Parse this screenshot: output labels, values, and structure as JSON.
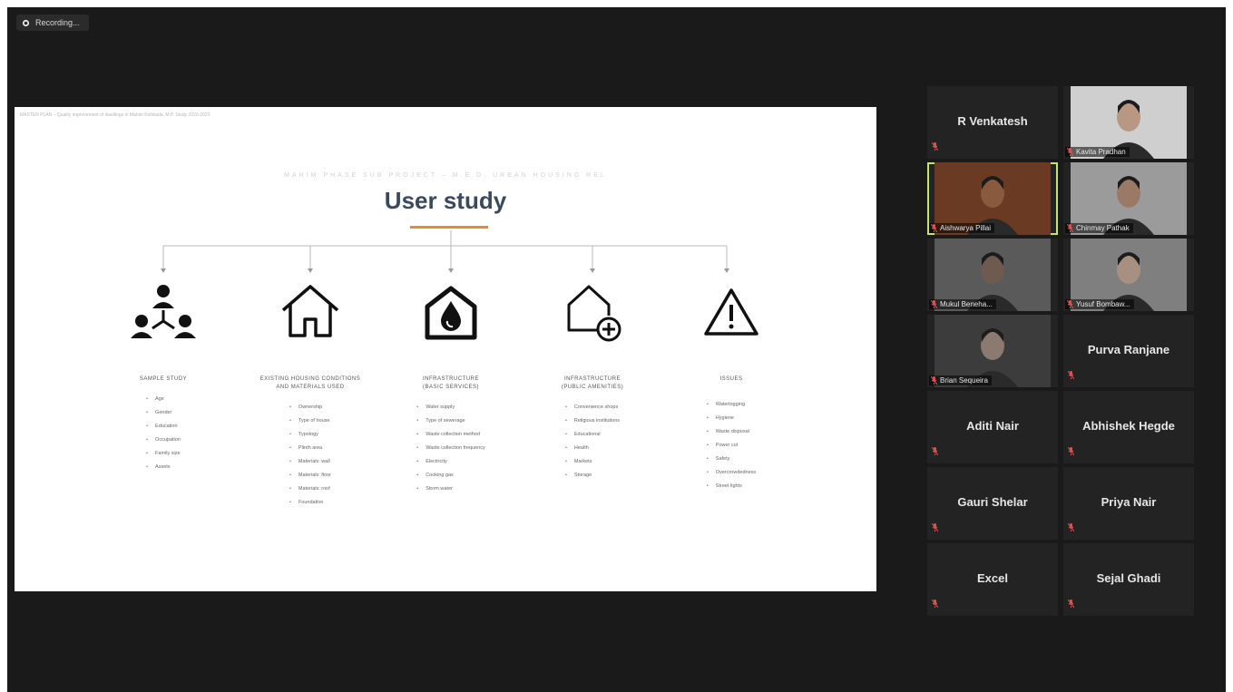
{
  "recording": {
    "label": "Recording..."
  },
  "slide": {
    "header": "MASTER PLAN – Quality improvement of dwellings in Mahim Koliwada, M.P. Study 2020-2021",
    "subtitle": "MAHIM PHASE SUB PROJECT – M.E.D. URBAN HOUSING REL",
    "title": "User study",
    "columns": [
      {
        "icon": "people-network-icon",
        "title": [
          "SAMPLE STUDY"
        ],
        "items": [
          "Age",
          "Gender",
          "Education",
          "Occupation",
          "Family size",
          "Assets"
        ]
      },
      {
        "icon": "house-outline-icon",
        "title": [
          "EXISTING HOUSING CONDITIONS",
          "AND MATERIALS USED"
        ],
        "items": [
          "Ownership",
          "Type of house",
          "Typology",
          "Plinth area",
          "Materials: wall",
          "Materials: floor",
          "Materials: roof",
          "Foundation"
        ]
      },
      {
        "icon": "water-drop-house-icon",
        "title": [
          "INFRASTRUCTURE",
          "(BASIC SERVICES)"
        ],
        "items": [
          "Water supply",
          "Type of sewerage",
          "Waste collection method",
          "Waste collection frequency",
          "Electricity",
          "Cooking gas",
          "Storm water"
        ]
      },
      {
        "icon": "house-plus-icon",
        "title": [
          "INFRASTRUCTURE",
          "(PUBLIC AMENITIES)"
        ],
        "items": [
          "Convenience shops",
          "Religious institutions",
          "Educational",
          "Health",
          "Markets",
          "Storage"
        ]
      },
      {
        "icon": "warning-icon",
        "title": [
          "ISSUES"
        ],
        "items": [
          "Waterlogging",
          "Hygiene",
          "Waste disposal",
          "Power cut",
          "Safety",
          "Overcrowdedness",
          "Street lights"
        ]
      }
    ]
  },
  "participants": [
    {
      "name": "R Venkatesh",
      "video": false
    },
    {
      "name": "Kavita Pradhan",
      "video": true,
      "skin": "#b89882",
      "bg": "#cfcfcf"
    },
    {
      "name": "Aishwarya Pillai",
      "video": true,
      "active": true,
      "skin": "#8a5a3e",
      "bg": "#6a3a22"
    },
    {
      "name": "Chinmay Pathak",
      "video": true,
      "skin": "#9a7a66",
      "bg": "#9b9b9b"
    },
    {
      "name": "Mukul Beneha...",
      "video": true,
      "skin": "#6f5a50",
      "bg": "#5a5a5a"
    },
    {
      "name": "Yusuf Bombaw...",
      "video": true,
      "skin": "#a7907f",
      "bg": "#7f7f7f"
    },
    {
      "name": "Brian Sequeira",
      "video": true,
      "skin": "#8a7a70",
      "bg": "#3c3c3c"
    },
    {
      "name": "Purva Ranjane",
      "video": false
    },
    {
      "name": "Aditi Nair",
      "video": false
    },
    {
      "name": "Abhishek Hegde",
      "video": false
    },
    {
      "name": "Gauri Shelar",
      "video": false
    },
    {
      "name": "Priya Nair",
      "video": false
    },
    {
      "name": "Excel",
      "video": false
    },
    {
      "name": "Sejal Ghadi",
      "video": false
    }
  ],
  "colors": {
    "accent": "#e8893a",
    "active_speaker": "#c6e36b",
    "mic_muted": "#d9534f"
  }
}
